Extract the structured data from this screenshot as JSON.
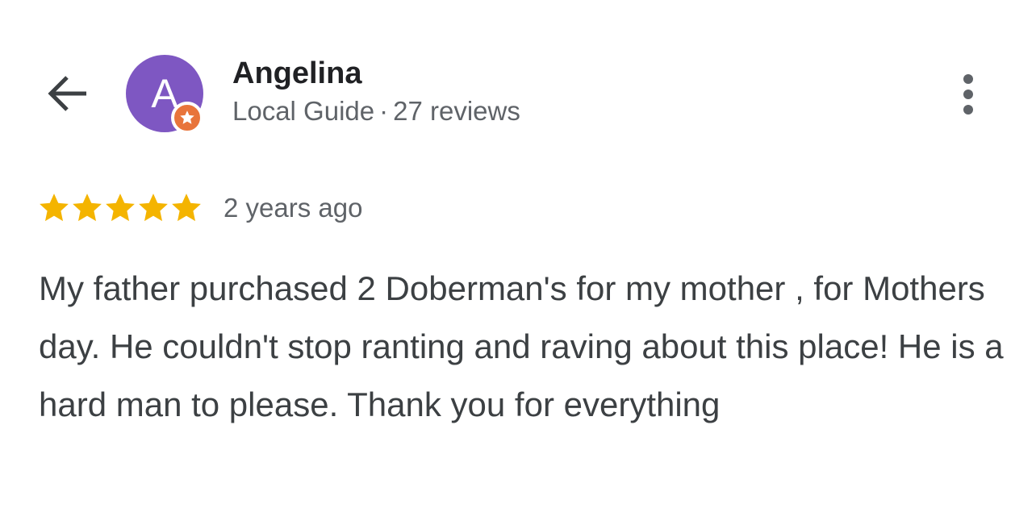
{
  "header": {
    "back_icon": "arrow-back-icon",
    "more_icon": "more-vertical-icon"
  },
  "reviewer": {
    "avatar_initial": "A",
    "avatar_color": "#7e57c2",
    "badge_icon": "local-guide-star-icon",
    "badge_color": "#e8743b",
    "name": "Angelina",
    "level": "Local Guide",
    "separator": "·",
    "review_count": "27 reviews"
  },
  "review": {
    "rating": 5,
    "max_rating": 5,
    "star_color": "#f4b400",
    "date": "2 years ago",
    "text": "My father purchased 2 Doberman's for my mother , for Mothers day. He couldn't stop ranting and raving about this place! He is a hard man to please. Thank you for everything"
  }
}
